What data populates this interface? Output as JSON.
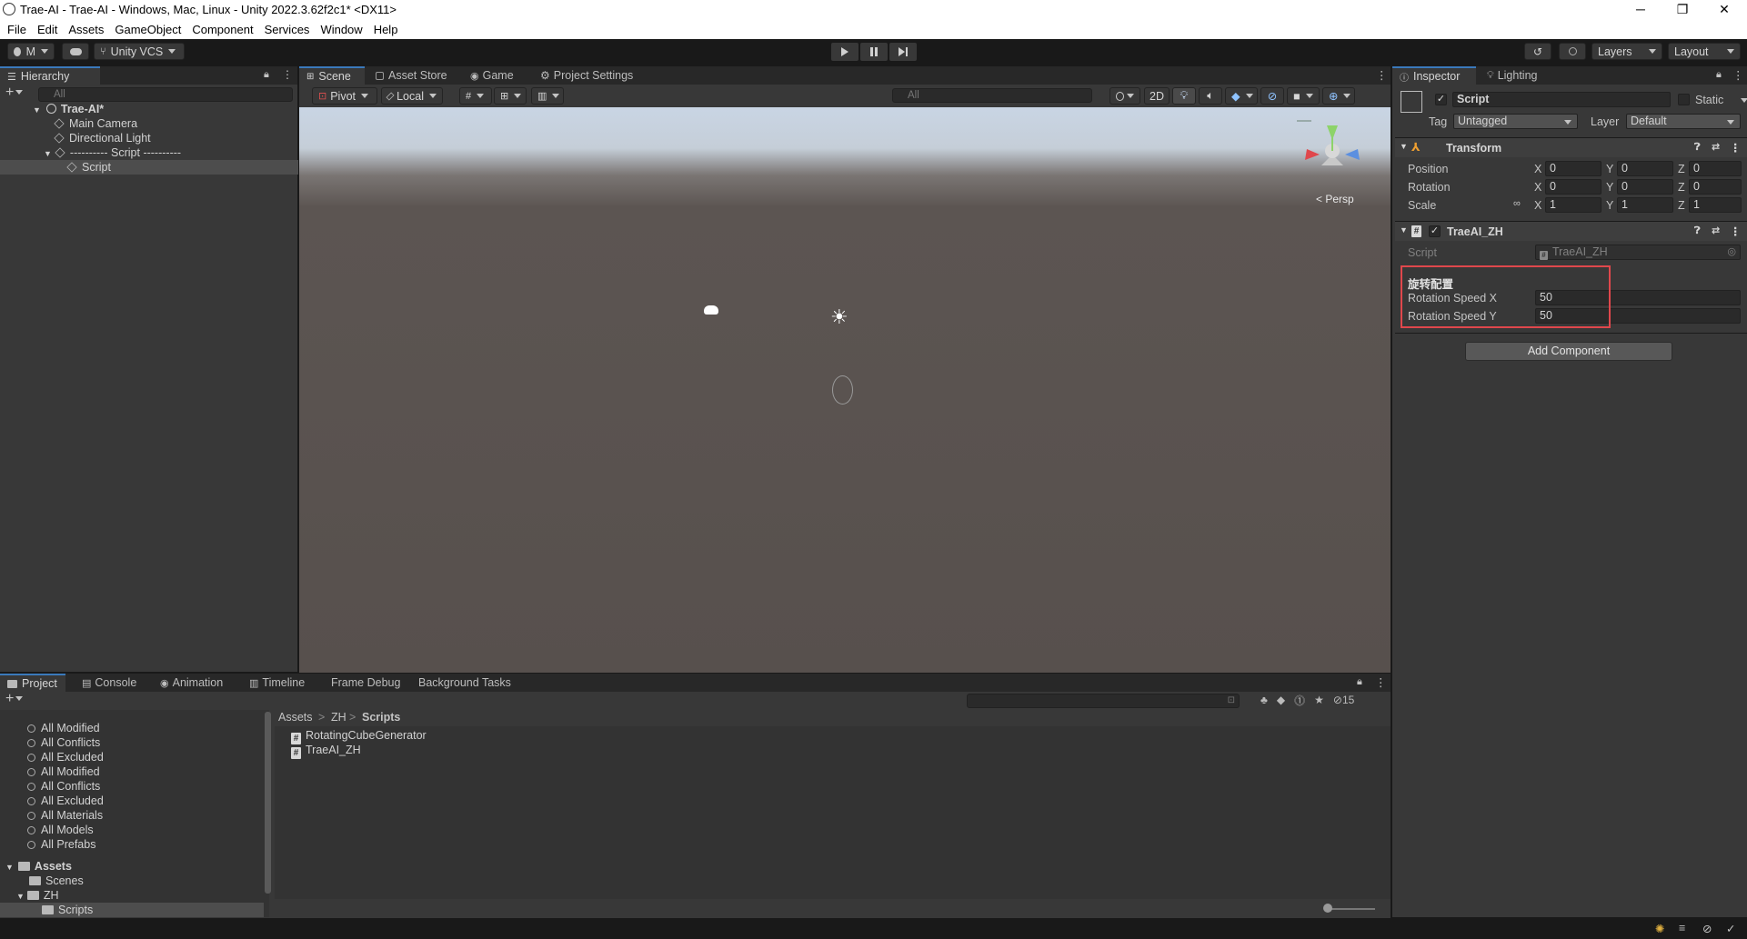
{
  "window": {
    "title": "Trae-AI - Trae-AI - Windows, Mac, Linux - Unity 2022.3.62f2c1* <DX11>",
    "minimize": "─",
    "maximize": "❐",
    "close": "✕"
  },
  "menu": [
    "File",
    "Edit",
    "Assets",
    "GameObject",
    "Component",
    "Services",
    "Window",
    "Help"
  ],
  "toolbar": {
    "account": "M",
    "vcs": "Unity VCS",
    "layers": "Layers",
    "layout": "Layout"
  },
  "hierarchy": {
    "tab": "Hierarchy",
    "search_placeholder": "All",
    "items": [
      {
        "label": "Trae-AI*"
      },
      {
        "label": "Main Camera"
      },
      {
        "label": "Directional Light"
      },
      {
        "label": "---------- Script ----------"
      },
      {
        "label": "Script"
      }
    ]
  },
  "scene_tabs": [
    "Scene",
    "Asset Store",
    "Game",
    "Project Settings"
  ],
  "scene_toolbar": {
    "pivot": "Pivot",
    "local": "Local",
    "search_placeholder": "All",
    "mode2d": "2D",
    "persp": "< Persp"
  },
  "inspector": {
    "tabs": [
      "Inspector",
      "Lighting"
    ],
    "object_name": "Script",
    "static_label": "Static",
    "tag_label": "Tag",
    "tag_value": "Untagged",
    "layer_label": "Layer",
    "layer_value": "Default",
    "transform": {
      "title": "Transform",
      "rows": [
        {
          "label": "Position",
          "x": "0",
          "y": "0",
          "z": "0"
        },
        {
          "label": "Rotation",
          "x": "0",
          "y": "0",
          "z": "0"
        },
        {
          "label": "Scale",
          "x": "1",
          "y": "1",
          "z": "1"
        }
      ],
      "axis_x": "X",
      "axis_y": "Y",
      "axis_z": "Z"
    },
    "component": {
      "title": "TraeAI_ZH",
      "script_label": "Script",
      "script_value": "TraeAI_ZH",
      "section": "旋转配置",
      "speed_x_label": "Rotation Speed X",
      "speed_x_value": "50",
      "speed_y_label": "Rotation Speed Y",
      "speed_y_value": "50",
      "highlight_color": "#e0474c"
    },
    "add_component": "Add Component"
  },
  "bottom_tabs": [
    "Project",
    "Console",
    "Animation",
    "Timeline",
    "Frame Debug",
    "Background Tasks"
  ],
  "project": {
    "favorites": [
      "All Modified",
      "All Conflicts",
      "All Excluded",
      "All Modified",
      "All Conflicts",
      "All Excluded",
      "All Materials",
      "All Models",
      "All Prefabs"
    ],
    "assets_root": "Assets",
    "folders": [
      {
        "label": "Scenes"
      },
      {
        "label": "ZH"
      },
      {
        "label": "Scripts"
      }
    ],
    "breadcrumb": {
      "a": "Assets",
      "b": "ZH",
      "c": "Scripts",
      "sep": ">"
    },
    "files": [
      "RotatingCubeGenerator",
      "TraeAI_ZH"
    ],
    "hidden_count": "15"
  }
}
